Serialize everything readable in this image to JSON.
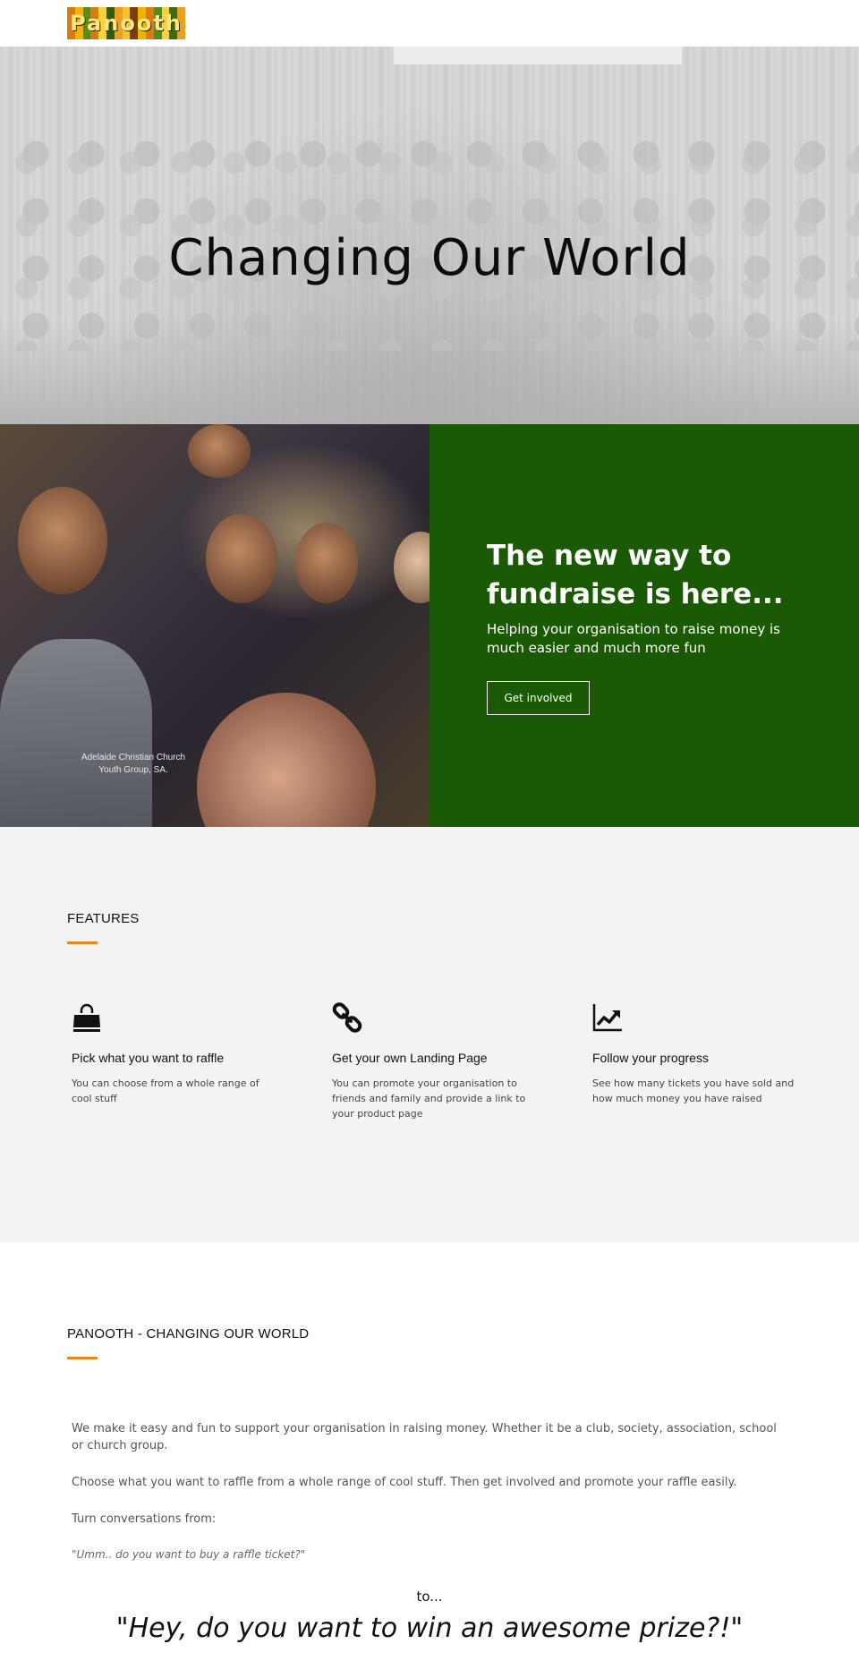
{
  "header": {
    "logo_text": "Panooth",
    "logo_colors": [
      "#d97b12",
      "#f0b400",
      "#5a8a1a",
      "#d97b12",
      "#f7d23a",
      "#2c5e10",
      "#e8a020",
      "#f4c430",
      "#7a3e0a",
      "#f0b400",
      "#d97b12",
      "#5a8a1a",
      "#f7d23a",
      "#3b6b14",
      "#e8a020"
    ]
  },
  "hero": {
    "title": "Changing Our World"
  },
  "split": {
    "photo_caption_line1": "Adelaide Christian Church",
    "photo_caption_line2": "Youth Group, SA.",
    "headline": "The new way to fundraise is here...",
    "subtext": "Helping your organisation to raise money is much easier and much more fun",
    "cta_label": "Get involved",
    "accent_color": "#1b5a04"
  },
  "features": {
    "section_title": "FEATURES",
    "accent_color": "#e08a1c",
    "items": [
      {
        "icon": "shopping-bag-icon",
        "title": "Pick what you want to raffle",
        "text": "You can choose from a whole range of cool stuff"
      },
      {
        "icon": "link-icon",
        "title": "Get your own Landing Page",
        "text": "You can promote your organisation to friends and family and provide a link to your product page"
      },
      {
        "icon": "line-chart-icon",
        "title": "Follow your progress",
        "text": "See how many tickets you have sold and how much money you have raised"
      }
    ]
  },
  "about": {
    "section_title": "PANOOTH - CHANGING OUR WORLD",
    "paragraphs": [
      "We make it easy and fun to support your organisation in raising money.  Whether it be a club, society, association, school or church group.",
      "Choose what you want to raffle from a whole range of cool stuff.  Then get involved and promote your raffle easily.",
      "Turn conversations from:"
    ],
    "quote_from": "\"Umm..  do you want to buy a raffle ticket?\"",
    "to_text": "to...",
    "quote_to": "\"Hey, do you want to win an awesome prize?!\""
  }
}
